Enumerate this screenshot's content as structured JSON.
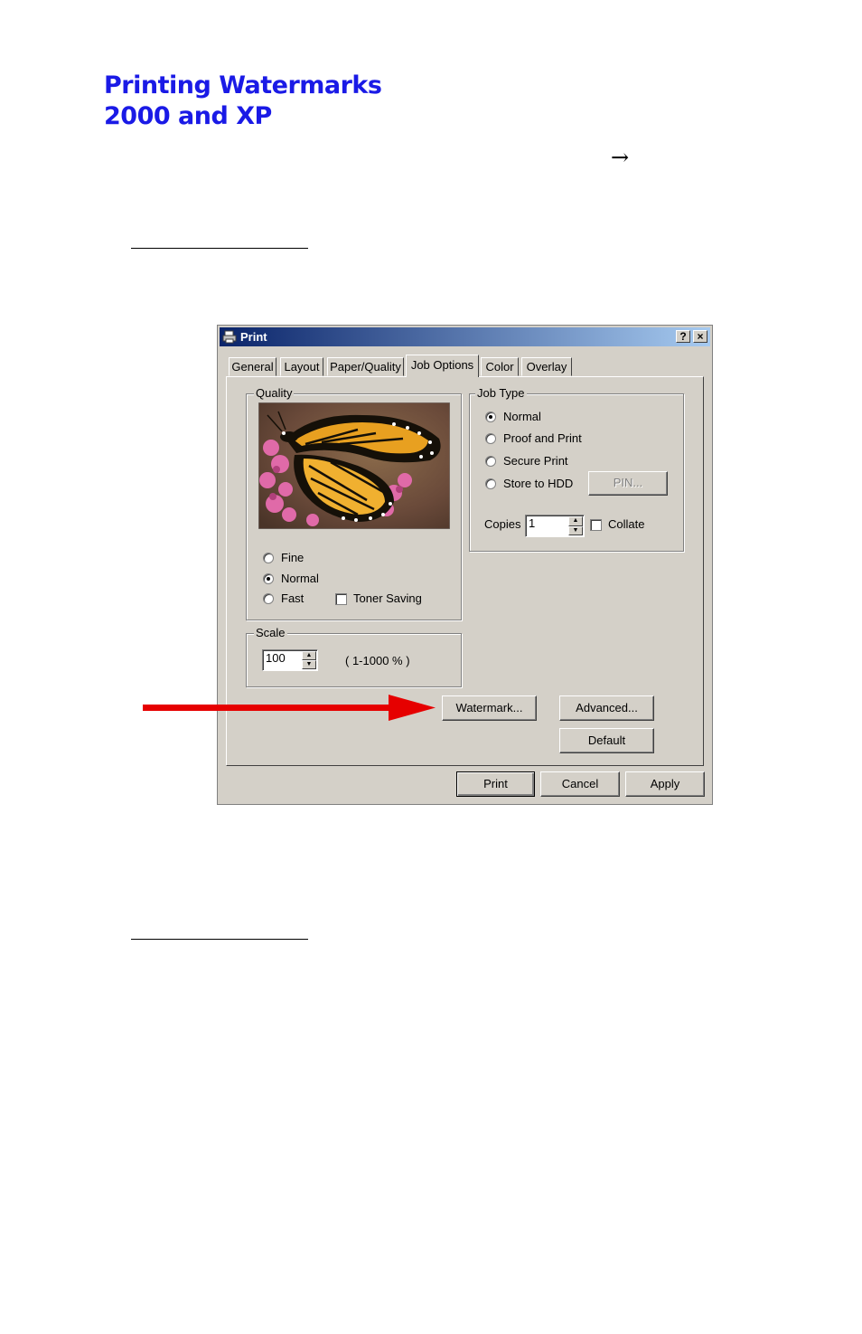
{
  "document": {
    "title_line1": "Printing Watermarks",
    "title_line2": "2000 and XP",
    "arrow_glyph": "→"
  },
  "dialog": {
    "title": "Print",
    "help_button": "?",
    "close_button": "×",
    "tabs": [
      "General",
      "Layout",
      "Paper/Quality",
      "Job Options",
      "Color",
      "Overlay"
    ],
    "active_tab": "Job Options",
    "quality": {
      "label": "Quality",
      "preview_image": "monarch-butterfly-photo",
      "options": [
        "Fine",
        "Normal",
        "Fast"
      ],
      "selected": "Normal",
      "toner_saving_label": "Toner Saving",
      "toner_saving_checked": false
    },
    "scale": {
      "label": "Scale",
      "value": "100",
      "range_text": "( 1-1000 % )"
    },
    "job_type": {
      "label": "Job Type",
      "options": [
        "Normal",
        "Proof and Print",
        "Secure Print",
        "Store to HDD"
      ],
      "selected": "Normal",
      "pin_button": "PIN...",
      "copies_label": "Copies",
      "copies_value": "1",
      "collate_label": "Collate",
      "collate_checked": false
    },
    "buttons": {
      "watermark": "Watermark...",
      "advanced": "Advanced...",
      "default": "Default",
      "print": "Print",
      "cancel": "Cancel",
      "apply": "Apply"
    }
  },
  "colors": {
    "heading": "#1a1ae6",
    "dialog_face": "#d4d0c8",
    "titlebar_start": "#0a246a",
    "titlebar_end": "#a6caf0",
    "callout_arrow": "#e60000"
  }
}
